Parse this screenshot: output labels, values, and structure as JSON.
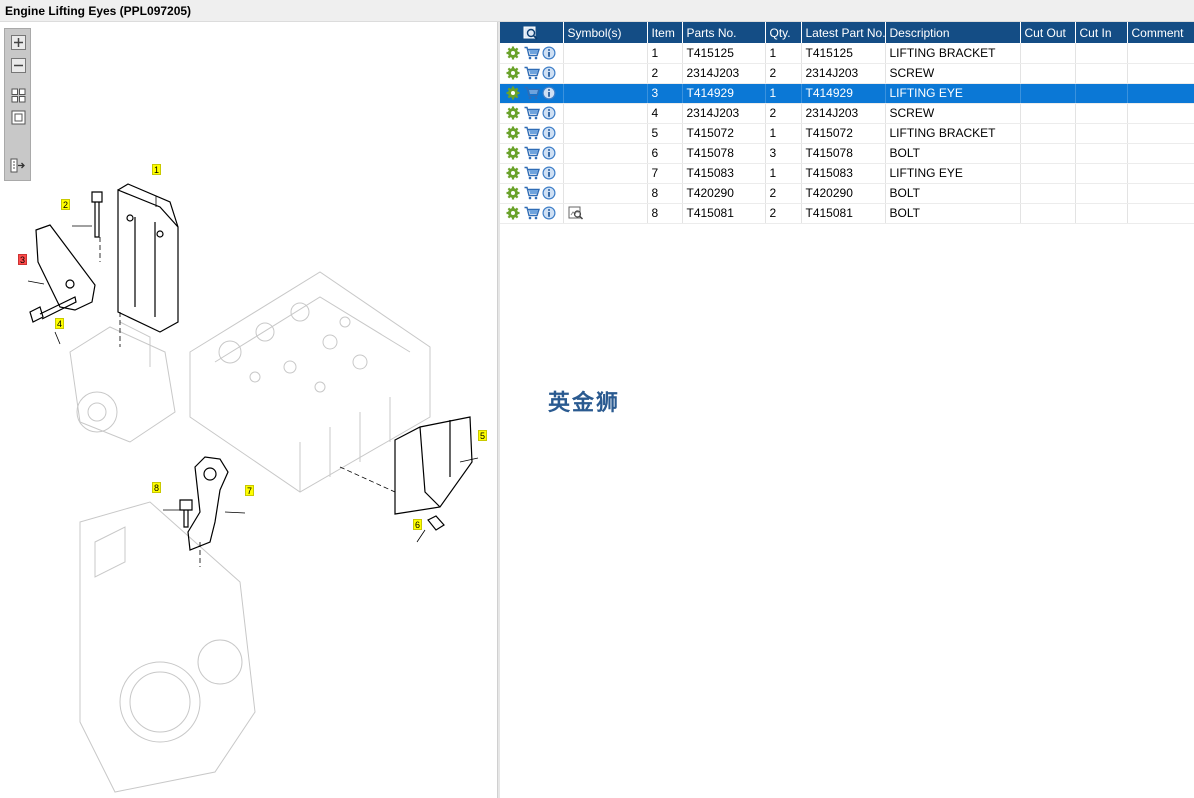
{
  "window": {
    "title": "Engine Lifting Eyes (PPL097205)"
  },
  "zoom_tools": [
    {
      "name": "zoom-in-icon"
    },
    {
      "name": "zoom-out-icon"
    },
    {
      "name": "fit-page-icon"
    },
    {
      "name": "actual-size-icon"
    },
    {
      "name": "export-icon"
    }
  ],
  "diagram": {
    "callouts": [
      {
        "label": "1",
        "selected": false
      },
      {
        "label": "2",
        "selected": false
      },
      {
        "label": "3",
        "selected": true
      },
      {
        "label": "4",
        "selected": false
      },
      {
        "label": "5",
        "selected": false
      },
      {
        "label": "6",
        "selected": false
      },
      {
        "label": "7",
        "selected": false
      },
      {
        "label": "8",
        "selected": false
      }
    ]
  },
  "table": {
    "header_icon": "search-parts-icon",
    "columns": [
      "Symbol(s)",
      "Item",
      "Parts No.",
      "Qty.",
      "Latest Part No.",
      "Description",
      "Cut Out",
      "Cut In",
      "Comment"
    ],
    "rows": [
      {
        "item": "1",
        "part_no": "T415125",
        "qty": "1",
        "latest": "T415125",
        "desc": "LIFTING BRACKET",
        "cut_out": "",
        "cut_in": "",
        "comment": "",
        "symbol": "",
        "selected": false
      },
      {
        "item": "2",
        "part_no": "2314J203",
        "qty": "2",
        "latest": "2314J203",
        "desc": "SCREW",
        "cut_out": "",
        "cut_in": "",
        "comment": "",
        "symbol": "",
        "selected": false
      },
      {
        "item": "3",
        "part_no": "T414929",
        "qty": "1",
        "latest": "T414929",
        "desc": "LIFTING EYE",
        "cut_out": "",
        "cut_in": "",
        "comment": "",
        "symbol": "",
        "selected": true
      },
      {
        "item": "4",
        "part_no": "2314J203",
        "qty": "2",
        "latest": "2314J203",
        "desc": "SCREW",
        "cut_out": "",
        "cut_in": "",
        "comment": "",
        "symbol": "",
        "selected": false
      },
      {
        "item": "5",
        "part_no": "T415072",
        "qty": "1",
        "latest": "T415072",
        "desc": "LIFTING BRACKET",
        "cut_out": "",
        "cut_in": "",
        "comment": "",
        "symbol": "",
        "selected": false
      },
      {
        "item": "6",
        "part_no": "T415078",
        "qty": "3",
        "latest": "T415078",
        "desc": "BOLT",
        "cut_out": "",
        "cut_in": "",
        "comment": "",
        "symbol": "",
        "selected": false
      },
      {
        "item": "7",
        "part_no": "T415083",
        "qty": "1",
        "latest": "T415083",
        "desc": "LIFTING EYE",
        "cut_out": "",
        "cut_in": "",
        "comment": "",
        "symbol": "",
        "selected": false
      },
      {
        "item": "8",
        "part_no": "T420290",
        "qty": "2",
        "latest": "T420290",
        "desc": "BOLT",
        "cut_out": "",
        "cut_in": "",
        "comment": "",
        "symbol": "",
        "selected": false
      },
      {
        "item": "8",
        "part_no": "T415081",
        "qty": "2",
        "latest": "T415081",
        "desc": "BOLT",
        "cut_out": "",
        "cut_in": "",
        "comment": "",
        "symbol": "view-icon",
        "selected": false
      }
    ],
    "row_icons": [
      "gear-icon",
      "cart-icon",
      "info-icon"
    ]
  },
  "watermark": {
    "text": "英金狮"
  },
  "colors": {
    "header_bg": "#144d85",
    "selected_row": "#0b78d6",
    "callout_bg": "#ffff00",
    "callout_selected": "#ff4b4b"
  }
}
